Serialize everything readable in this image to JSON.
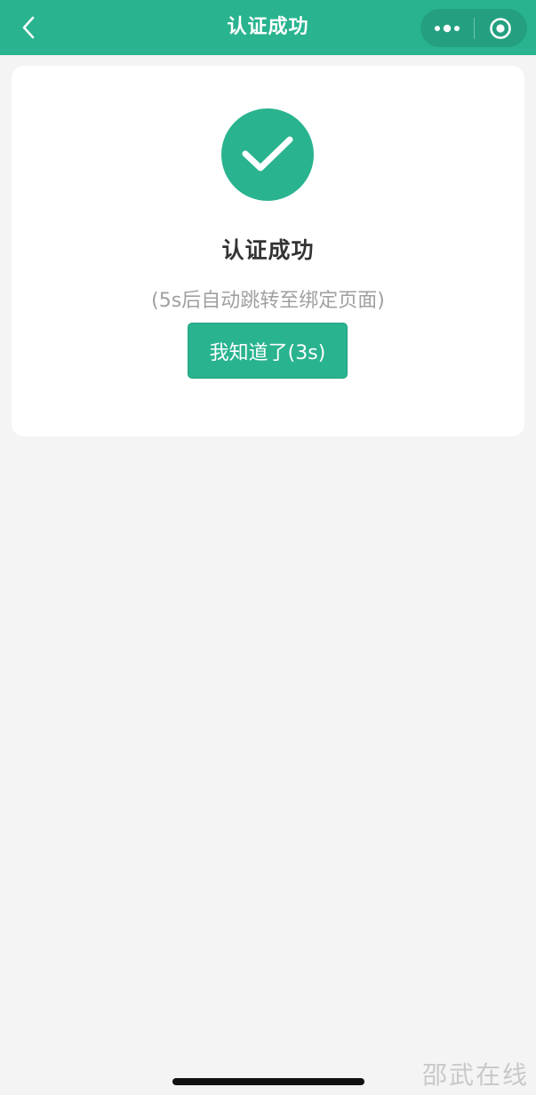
{
  "nav": {
    "title": "认证成功",
    "back_icon": "chevron-left-icon",
    "more_icon": "more-dots-icon",
    "close_icon": "target-close-icon"
  },
  "result": {
    "status_icon": "check-icon",
    "title": "认证成功",
    "note": "(5s后自动跳转至绑定页面)",
    "button_label": "我知道了(3s)"
  },
  "watermark": "邵武在线",
  "colors": {
    "accent": "#29b38f",
    "background": "#f4f4f4",
    "card": "#ffffff",
    "title_text": "#333333",
    "note_text": "#a0a0a0"
  }
}
